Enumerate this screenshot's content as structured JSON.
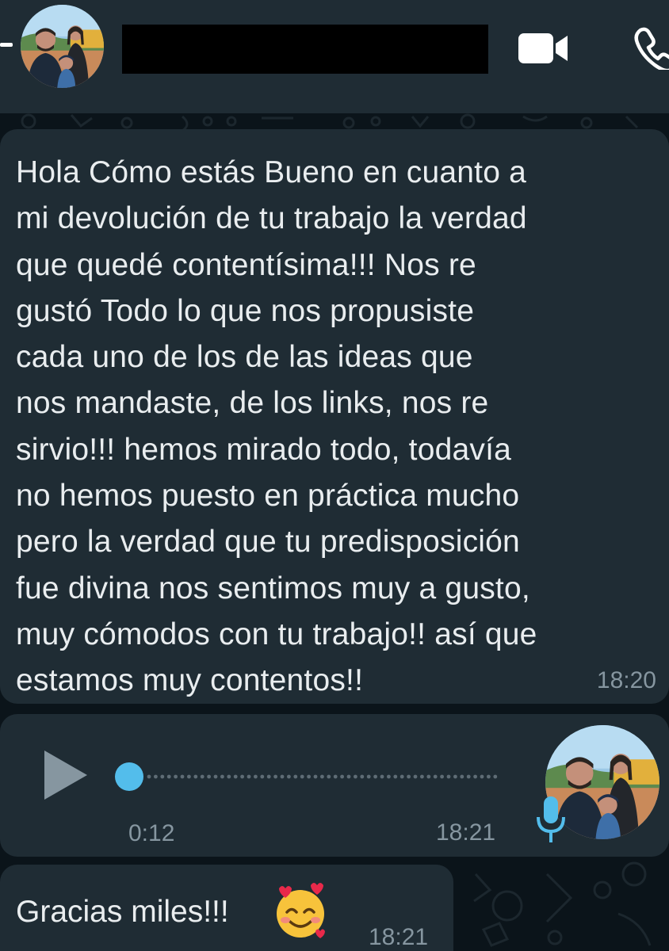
{
  "header": {
    "contact_name": "",
    "avatar_icon": "avatar-photo",
    "video_call_icon": "video-camera-icon",
    "voice_call_icon": "phone-icon",
    "background_color": "#1f2c34"
  },
  "chat": {
    "background_color": "#0b141a",
    "bubble_color": "#1f2c34",
    "messages": [
      {
        "type": "text",
        "text": "Hola Cómo estás Bueno en cuanto a\nmi devolución de tu trabajo la verdad\nque quedé contentísima!!! Nos re\ngustó Todo lo que nos propusiste\ncada uno de los de las ideas que\nnos mandaste, de los links, nos re\nsirvio!!! hemos mirado todo, todavía\nno hemos puesto en práctica mucho\npero la verdad que tu predisposición\nfue divina nos sentimos muy a gusto,\nmuy cómodos con tu trabajo!! así que\nestamos muy contentos!!",
        "time": "18:20"
      },
      {
        "type": "voice",
        "duration": "0:12",
        "time": "18:21",
        "progress": 0,
        "play_icon": "play-icon",
        "mic_icon": "microphone-icon",
        "accent_color": "#53bdeb"
      },
      {
        "type": "text",
        "text": "Gracias miles!!!",
        "emoji": "smiling-face-with-hearts",
        "time": "18:21"
      }
    ]
  }
}
